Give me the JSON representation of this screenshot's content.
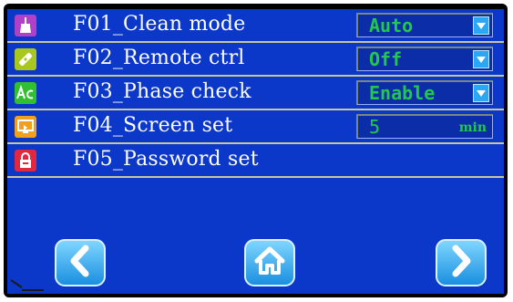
{
  "menu": {
    "rows": [
      {
        "label": "F01_Clean mode",
        "icon": "broom-icon",
        "icon_color": "#b040c8",
        "control": {
          "value": "Auto",
          "dropdown": true
        }
      },
      {
        "label": "F02_Remote ctrl",
        "icon": "remote-icon",
        "icon_color": "#a8c820",
        "control": {
          "value": "Off",
          "dropdown": true
        }
      },
      {
        "label": "F03_Phase check",
        "icon": "phase-check-icon",
        "icon_color": "#30c030",
        "control": {
          "value": "Enable",
          "dropdown": true
        }
      },
      {
        "label": "F04_Screen set",
        "icon": "screen-icon",
        "icon_color": "#f0a020",
        "control": {
          "value": "5",
          "unit": "min"
        }
      },
      {
        "label": "F05_Password set",
        "icon": "lock-icon",
        "icon_color": "#e02840"
      }
    ]
  },
  "nav": {
    "prev": "chevron-left-icon",
    "home": "home-icon",
    "next": "chevron-right-icon"
  },
  "colors": {
    "screen_bg": "#0b38c9",
    "value_text": "#22c84a",
    "nav_button": "#3aa8f0"
  }
}
